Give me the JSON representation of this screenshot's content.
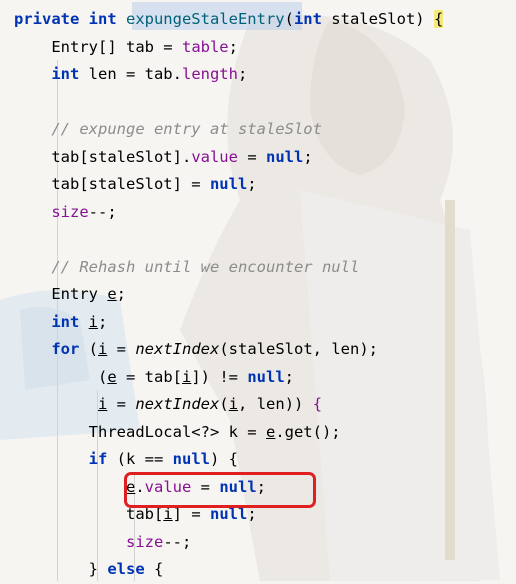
{
  "editor": {
    "lines": [
      {
        "tokens": [
          {
            "t": "private int ",
            "c": "kw"
          },
          {
            "t": "expungeStaleEntry",
            "c": "fn"
          },
          {
            "t": "(",
            "c": "pl"
          },
          {
            "t": "int ",
            "c": "kw"
          },
          {
            "t": "staleSlot) ",
            "c": "pl"
          },
          {
            "t": "{",
            "c": "brace-hl"
          }
        ]
      },
      {
        "tokens": [
          {
            "t": "    Entry[] tab = ",
            "c": "pl"
          },
          {
            "t": "table",
            "c": "fld"
          },
          {
            "t": ";",
            "c": "pl"
          }
        ]
      },
      {
        "tokens": [
          {
            "t": "    ",
            "c": "pl"
          },
          {
            "t": "int ",
            "c": "kw"
          },
          {
            "t": "len = tab.",
            "c": "pl"
          },
          {
            "t": "length",
            "c": "fld"
          },
          {
            "t": ";",
            "c": "pl"
          }
        ]
      },
      {
        "tokens": []
      },
      {
        "tokens": [
          {
            "t": "    // expunge entry at staleSlot",
            "c": "cm"
          }
        ]
      },
      {
        "tokens": [
          {
            "t": "    tab[staleSlot].",
            "c": "pl"
          },
          {
            "t": "value",
            "c": "fld"
          },
          {
            "t": " = ",
            "c": "pl"
          },
          {
            "t": "null",
            "c": "kw"
          },
          {
            "t": ";",
            "c": "pl"
          }
        ]
      },
      {
        "tokens": [
          {
            "t": "    tab[staleSlot] = ",
            "c": "pl"
          },
          {
            "t": "null",
            "c": "kw"
          },
          {
            "t": ";",
            "c": "pl"
          }
        ]
      },
      {
        "tokens": [
          {
            "t": "    ",
            "c": "pl"
          },
          {
            "t": "size",
            "c": "fld"
          },
          {
            "t": "--;",
            "c": "pl"
          }
        ]
      },
      {
        "tokens": []
      },
      {
        "tokens": [
          {
            "t": "    // Rehash until we encounter null",
            "c": "cm"
          }
        ]
      },
      {
        "tokens": [
          {
            "t": "    Entry ",
            "c": "pl"
          },
          {
            "t": "e",
            "c": "ul"
          },
          {
            "t": ";",
            "c": "pl"
          }
        ]
      },
      {
        "tokens": [
          {
            "t": "    ",
            "c": "pl"
          },
          {
            "t": "int ",
            "c": "kw"
          },
          {
            "t": "i",
            "c": "ul"
          },
          {
            "t": ";",
            "c": "pl"
          }
        ]
      },
      {
        "tokens": [
          {
            "t": "    ",
            "c": "pl"
          },
          {
            "t": "for ",
            "c": "kw"
          },
          {
            "t": "(",
            "c": "pl"
          },
          {
            "t": "i",
            "c": "ul"
          },
          {
            "t": " = ",
            "c": "pl"
          },
          {
            "t": "nextIndex",
            "c": "st"
          },
          {
            "t": "(staleSlot, len);",
            "c": "pl"
          }
        ]
      },
      {
        "tokens": [
          {
            "t": "         (",
            "c": "pl"
          },
          {
            "t": "e",
            "c": "ul"
          },
          {
            "t": " = tab[",
            "c": "pl"
          },
          {
            "t": "i",
            "c": "ul"
          },
          {
            "t": "]) != ",
            "c": "pl"
          },
          {
            "t": "null",
            "c": "kw"
          },
          {
            "t": ";",
            "c": "pl"
          }
        ]
      },
      {
        "tokens": [
          {
            "t": "         ",
            "c": "pl"
          },
          {
            "t": "i",
            "c": "ul"
          },
          {
            "t": " = ",
            "c": "pl"
          },
          {
            "t": "nextIndex",
            "c": "st"
          },
          {
            "t": "(",
            "c": "pl"
          },
          {
            "t": "i",
            "c": "ul"
          },
          {
            "t": ", len)) ",
            "c": "pl"
          },
          {
            "t": "{",
            "c": "fld"
          }
        ]
      },
      {
        "tokens": [
          {
            "t": "        ThreadLocal<?> k = ",
            "c": "pl"
          },
          {
            "t": "e",
            "c": "ul"
          },
          {
            "t": ".get();",
            "c": "pl"
          }
        ]
      },
      {
        "tokens": [
          {
            "t": "        ",
            "c": "pl"
          },
          {
            "t": "if ",
            "c": "kw"
          },
          {
            "t": "(k == ",
            "c": "pl"
          },
          {
            "t": "null",
            "c": "kw"
          },
          {
            "t": ") {",
            "c": "pl"
          }
        ]
      },
      {
        "tokens": [
          {
            "t": "            ",
            "c": "pl"
          },
          {
            "t": "e",
            "c": "ul"
          },
          {
            "t": ".",
            "c": "pl"
          },
          {
            "t": "value",
            "c": "fld"
          },
          {
            "t": " = ",
            "c": "pl"
          },
          {
            "t": "null",
            "c": "kw"
          },
          {
            "t": ";",
            "c": "pl"
          }
        ]
      },
      {
        "tokens": [
          {
            "t": "            tab[",
            "c": "pl"
          },
          {
            "t": "i",
            "c": "ul"
          },
          {
            "t": "] = ",
            "c": "pl"
          },
          {
            "t": "null",
            "c": "kw"
          },
          {
            "t": ";",
            "c": "pl"
          }
        ]
      },
      {
        "tokens": [
          {
            "t": "            ",
            "c": "pl"
          },
          {
            "t": "size",
            "c": "fld"
          },
          {
            "t": "--;",
            "c": "pl"
          }
        ]
      },
      {
        "tokens": [
          {
            "t": "        } ",
            "c": "pl"
          },
          {
            "t": "else ",
            "c": "kw"
          },
          {
            "t": "{",
            "c": "pl"
          }
        ]
      }
    ]
  },
  "colors": {
    "keyword": "#0033b3",
    "field": "#871094",
    "comment": "#8c8c8c",
    "method": "#00627a",
    "annotation_box": "#e02020",
    "brace_highlight": "#f5e97a"
  }
}
